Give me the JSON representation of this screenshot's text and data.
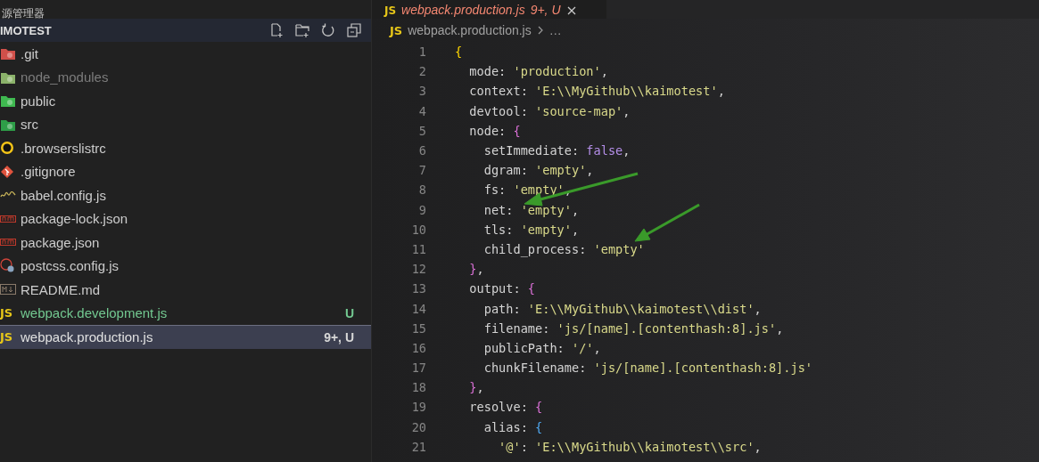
{
  "explorer": {
    "title": "源管理器",
    "folder": "IMOTEST",
    "items": [
      {
        "name": ".git",
        "kind": "git-folder",
        "color": "#cccccc",
        "selected": false
      },
      {
        "name": "node_modules",
        "kind": "node-folder",
        "color": "#7c7c7c",
        "selected": false
      },
      {
        "name": "public",
        "kind": "public-folder",
        "color": "#cccccc",
        "selected": false
      },
      {
        "name": "src",
        "kind": "src-folder",
        "color": "#cccccc",
        "selected": false
      },
      {
        "name": ".browserslistrc",
        "kind": "browserslist",
        "color": "#cccccc",
        "selected": false
      },
      {
        "name": ".gitignore",
        "kind": "git",
        "color": "#cccccc",
        "selected": false
      },
      {
        "name": "babel.config.js",
        "kind": "babel",
        "color": "#cccccc",
        "selected": false
      },
      {
        "name": "package-lock.json",
        "kind": "npm",
        "color": "#cccccc",
        "selected": false
      },
      {
        "name": "package.json",
        "kind": "npm",
        "color": "#cccccc",
        "selected": false
      },
      {
        "name": "postcss.config.js",
        "kind": "postcss",
        "color": "#cccccc",
        "selected": false
      },
      {
        "name": "README.md",
        "kind": "markdown",
        "color": "#cccccc",
        "selected": false
      },
      {
        "name": "webpack.development.js",
        "kind": "js",
        "icon_text": "JS",
        "color": "#73c991",
        "badge": "U",
        "selected": false
      },
      {
        "name": "webpack.production.js",
        "kind": "js",
        "icon_text": "JS",
        "color": "#e0e0e0",
        "badge": "9+, U",
        "selected": true
      }
    ]
  },
  "tab": {
    "icon_text": "JS",
    "label": "webpack.production.js",
    "badge": "9+, U"
  },
  "breadcrumb": {
    "icon_text": "JS",
    "file": "webpack.production.js",
    "more": "…"
  },
  "code": [
    {
      "number": "1",
      "tokens": [
        {
          "text": "{",
          "kind": "brace1"
        }
      ]
    },
    {
      "number": "2",
      "tokens": [
        {
          "text": "  mode",
          "kind": "key"
        },
        {
          "text": ": ",
          "kind": "punct"
        },
        {
          "text": "'production'",
          "kind": "string"
        },
        {
          "text": ",",
          "kind": "punct"
        }
      ]
    },
    {
      "number": "3",
      "tokens": [
        {
          "text": "  context",
          "kind": "key"
        },
        {
          "text": ": ",
          "kind": "punct"
        },
        {
          "text": "'E:\\\\MyGithub\\\\kaimotest'",
          "kind": "string"
        },
        {
          "text": ",",
          "kind": "punct"
        }
      ]
    },
    {
      "number": "4",
      "tokens": [
        {
          "text": "  devtool",
          "kind": "key"
        },
        {
          "text": ": ",
          "kind": "punct"
        },
        {
          "text": "'source-map'",
          "kind": "string"
        },
        {
          "text": ",",
          "kind": "punct"
        }
      ]
    },
    {
      "number": "5",
      "tokens": [
        {
          "text": "  node",
          "kind": "key"
        },
        {
          "text": ": ",
          "kind": "punct"
        },
        {
          "text": "{",
          "kind": "brace2"
        }
      ]
    },
    {
      "number": "6",
      "tokens": [
        {
          "text": "    setImmediate",
          "kind": "key"
        },
        {
          "text": ": ",
          "kind": "punct"
        },
        {
          "text": "false",
          "kind": "bool"
        },
        {
          "text": ",",
          "kind": "punct"
        }
      ]
    },
    {
      "number": "7",
      "tokens": [
        {
          "text": "    dgram",
          "kind": "key"
        },
        {
          "text": ": ",
          "kind": "punct"
        },
        {
          "text": "'empty'",
          "kind": "string"
        },
        {
          "text": ",",
          "kind": "punct"
        }
      ]
    },
    {
      "number": "8",
      "tokens": [
        {
          "text": "    fs",
          "kind": "key"
        },
        {
          "text": ": ",
          "kind": "punct"
        },
        {
          "text": "'empty'",
          "kind": "string"
        },
        {
          "text": ",",
          "kind": "punct"
        }
      ]
    },
    {
      "number": "9",
      "tokens": [
        {
          "text": "    net",
          "kind": "key"
        },
        {
          "text": ": ",
          "kind": "punct"
        },
        {
          "text": "'empty'",
          "kind": "string"
        },
        {
          "text": ",",
          "kind": "punct"
        }
      ]
    },
    {
      "number": "10",
      "tokens": [
        {
          "text": "    tls",
          "kind": "key"
        },
        {
          "text": ": ",
          "kind": "punct"
        },
        {
          "text": "'empty'",
          "kind": "string"
        },
        {
          "text": ",",
          "kind": "punct"
        }
      ]
    },
    {
      "number": "11",
      "tokens": [
        {
          "text": "    child_process",
          "kind": "key"
        },
        {
          "text": ": ",
          "kind": "punct"
        },
        {
          "text": "'empty'",
          "kind": "string"
        }
      ]
    },
    {
      "number": "12",
      "tokens": [
        {
          "text": "  }",
          "kind": "brace2"
        },
        {
          "text": ",",
          "kind": "punct"
        }
      ]
    },
    {
      "number": "13",
      "tokens": [
        {
          "text": "  output",
          "kind": "key"
        },
        {
          "text": ": ",
          "kind": "punct"
        },
        {
          "text": "{",
          "kind": "brace2"
        }
      ]
    },
    {
      "number": "14",
      "tokens": [
        {
          "text": "    path",
          "kind": "key"
        },
        {
          "text": ": ",
          "kind": "punct"
        },
        {
          "text": "'E:\\\\MyGithub\\\\kaimotest\\\\dist'",
          "kind": "string"
        },
        {
          "text": ",",
          "kind": "punct"
        }
      ]
    },
    {
      "number": "15",
      "tokens": [
        {
          "text": "    filename",
          "kind": "key"
        },
        {
          "text": ": ",
          "kind": "punct"
        },
        {
          "text": "'js/[name].[contenthash:8].js'",
          "kind": "string"
        },
        {
          "text": ",",
          "kind": "punct"
        }
      ]
    },
    {
      "number": "16",
      "tokens": [
        {
          "text": "    publicPath",
          "kind": "key"
        },
        {
          "text": ": ",
          "kind": "punct"
        },
        {
          "text": "'/'",
          "kind": "string"
        },
        {
          "text": ",",
          "kind": "punct"
        }
      ]
    },
    {
      "number": "17",
      "tokens": [
        {
          "text": "    chunkFilename",
          "kind": "key"
        },
        {
          "text": ": ",
          "kind": "punct"
        },
        {
          "text": "'js/[name].[contenthash:8].js'",
          "kind": "string"
        }
      ]
    },
    {
      "number": "18",
      "tokens": [
        {
          "text": "  }",
          "kind": "brace2"
        },
        {
          "text": ",",
          "kind": "punct"
        }
      ]
    },
    {
      "number": "19",
      "tokens": [
        {
          "text": "  resolve",
          "kind": "key"
        },
        {
          "text": ": ",
          "kind": "punct"
        },
        {
          "text": "{",
          "kind": "brace2"
        }
      ]
    },
    {
      "number": "20",
      "tokens": [
        {
          "text": "    alias",
          "kind": "key"
        },
        {
          "text": ": ",
          "kind": "punct"
        },
        {
          "text": "{",
          "kind": "brace3"
        }
      ]
    },
    {
      "number": "21",
      "tokens": [
        {
          "text": "      '@'",
          "kind": "string"
        },
        {
          "text": ": ",
          "kind": "punct"
        },
        {
          "text": "'E:\\\\MyGithub\\\\kaimotest\\\\src'",
          "kind": "string"
        },
        {
          "text": ",",
          "kind": "punct"
        }
      ]
    }
  ]
}
